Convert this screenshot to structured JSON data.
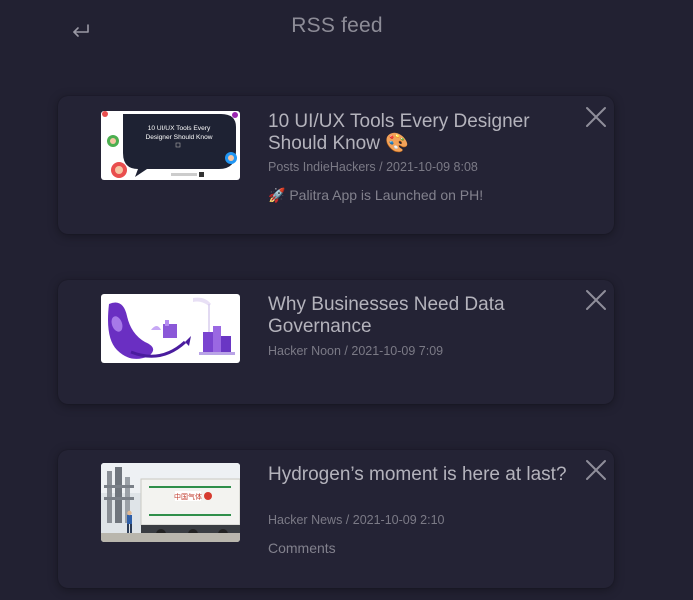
{
  "header": {
    "title": "RSS feed",
    "back_icon": "return-arrow-icon"
  },
  "feed": [
    {
      "title": "10 UI/UX Tools Every Designer Should Know 🎨",
      "source": "Posts IndieHackers",
      "date": "2021-10-09 8:08",
      "meta": "Posts IndieHackers / 2021-10-09 8:08",
      "description": "🚀 Palitra App is Launched on PH!",
      "thumb_text": "10 UI/UX Tools Every Designer Should Know"
    },
    {
      "title": "Why Businesses Need Data Governance",
      "source": "Hacker Noon",
      "date": "2021-10-09 7:09",
      "meta": "Hacker Noon / 2021-10-09 7:09",
      "description": ""
    },
    {
      "title": "Hydrogen’s moment is here at last?",
      "source": "Hacker News",
      "date": "2021-10-09 2:10",
      "meta": "Hacker News / 2021-10-09 2:10",
      "description": "Comments"
    }
  ],
  "colors": {
    "background": "#222132",
    "card": "#242335",
    "title_text": "#b4b3bc",
    "meta_text": "#7b7a86",
    "icon": "#9a99a5"
  }
}
